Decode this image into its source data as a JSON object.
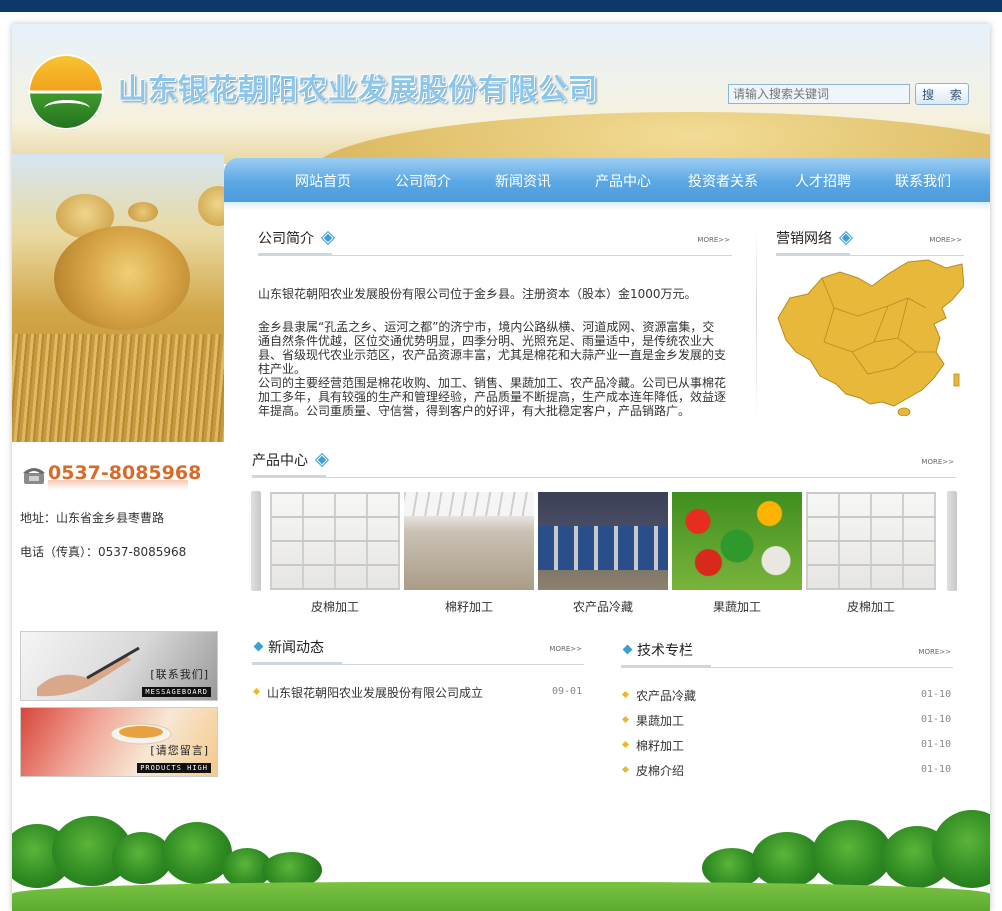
{
  "header": {
    "company_name": "山东银花朝阳农业发展股份有限公司",
    "search": {
      "placeholder": "请输入搜索关键词",
      "button_label": "搜 索"
    }
  },
  "nav": {
    "items": [
      {
        "label": "网站首页"
      },
      {
        "label": "公司简介"
      },
      {
        "label": "新闻资讯"
      },
      {
        "label": "产品中心"
      },
      {
        "label": "投资者关系"
      },
      {
        "label": "人才招聘"
      },
      {
        "label": "联系我们"
      }
    ]
  },
  "about": {
    "title": "公司简介",
    "more": "MORE>>",
    "paragraph_1": "山东银花朝阳农业发展股份有限公司位于金乡县。注册资本（股本）金1000万元。",
    "paragraph_2_lines": [
      "金乡县隶属“孔孟之乡、运河之都”的济宁市，境内公路纵横、河道成网、资源富集，交",
      "通自然条件优越，区位交通优势明显，四季分明、光照充足、雨量适中，是传统农业大",
      "县、省级现代农业示范区，农产品资源丰富，尤其是棉花和大蒜产业一直是金乡发展的支",
      "柱产业。",
      "公司的主要经营范围是棉花收购、加工、销售、果蔬加工、农产品冷藏。公司已从事棉花",
      "加工多年，具有较强的生产和管理经验，产品质量不断提高，生产成本连年降低，效益逐",
      "年提高。公司重质量、守信誉，得到客户的好评，有大批稳定客户，产品销路广。"
    ]
  },
  "network": {
    "title": "营销网络",
    "more": "MORE>>"
  },
  "contact": {
    "phone": "0537-8085968",
    "address": "地址：山东省金乡县枣曹路",
    "tel_fax": "电话（传真）：0537-8085968"
  },
  "products": {
    "title": "产品中心",
    "more": "MORE>>",
    "items": [
      {
        "label": "皮棉加工",
        "image": "cotton-bales"
      },
      {
        "label": "棉籽加工",
        "image": "cottonseed-pile"
      },
      {
        "label": "农产品冷藏",
        "image": "cold-storage"
      },
      {
        "label": "果蔬加工",
        "image": "vegetables"
      },
      {
        "label": "皮棉加工",
        "image": "cotton-bales"
      }
    ]
  },
  "news": {
    "title": "新闻动态",
    "more": "MORE>>",
    "items": [
      {
        "title": "山东银花朝阳农业发展股份有限公司成立",
        "date": "09-01"
      }
    ]
  },
  "tech": {
    "title": "技术专栏",
    "more": "MORE>>",
    "items": [
      {
        "title": "农产品冷藏",
        "date": "01-10"
      },
      {
        "title": "果蔬加工",
        "date": "01-10"
      },
      {
        "title": "棉籽加工",
        "date": "01-10"
      },
      {
        "title": "皮棉介绍",
        "date": "01-10"
      }
    ]
  },
  "banners": {
    "contact_text": "[联系我们]",
    "contact_sub": "MESSAGEBOARD",
    "message_text": "[请您留言]",
    "message_sub": "PRODUCTS HIGH"
  },
  "colors": {
    "nav": "#5aa7e4",
    "topbar": "#0d3868",
    "phone": "#d86a2a",
    "map": "#e8b83a"
  }
}
